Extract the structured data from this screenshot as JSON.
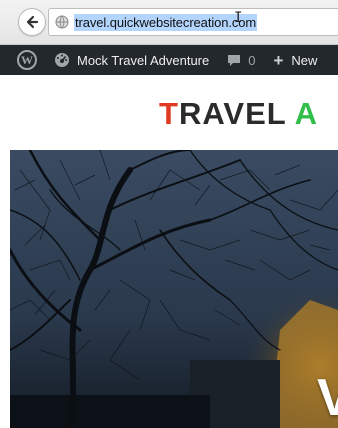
{
  "browser": {
    "url": "travel.quickwebsitecreation.com",
    "back_icon": "back-arrow-icon",
    "site_info_icon": "globe-icon"
  },
  "admin_bar": {
    "wp_logo": "W",
    "site_name": "Mock Travel Adventure",
    "comment_count": "0",
    "new_label": "New",
    "plus_symbol": "+",
    "background_color": "#23282d"
  },
  "site": {
    "logo_first_letter": "T",
    "logo_middle": "RAVEL ",
    "logo_second_initial": "A",
    "logo_first_color": "#e03a22",
    "logo_second_color": "#2fbf4a"
  },
  "hero": {
    "heading_visible_fragment": "V"
  }
}
